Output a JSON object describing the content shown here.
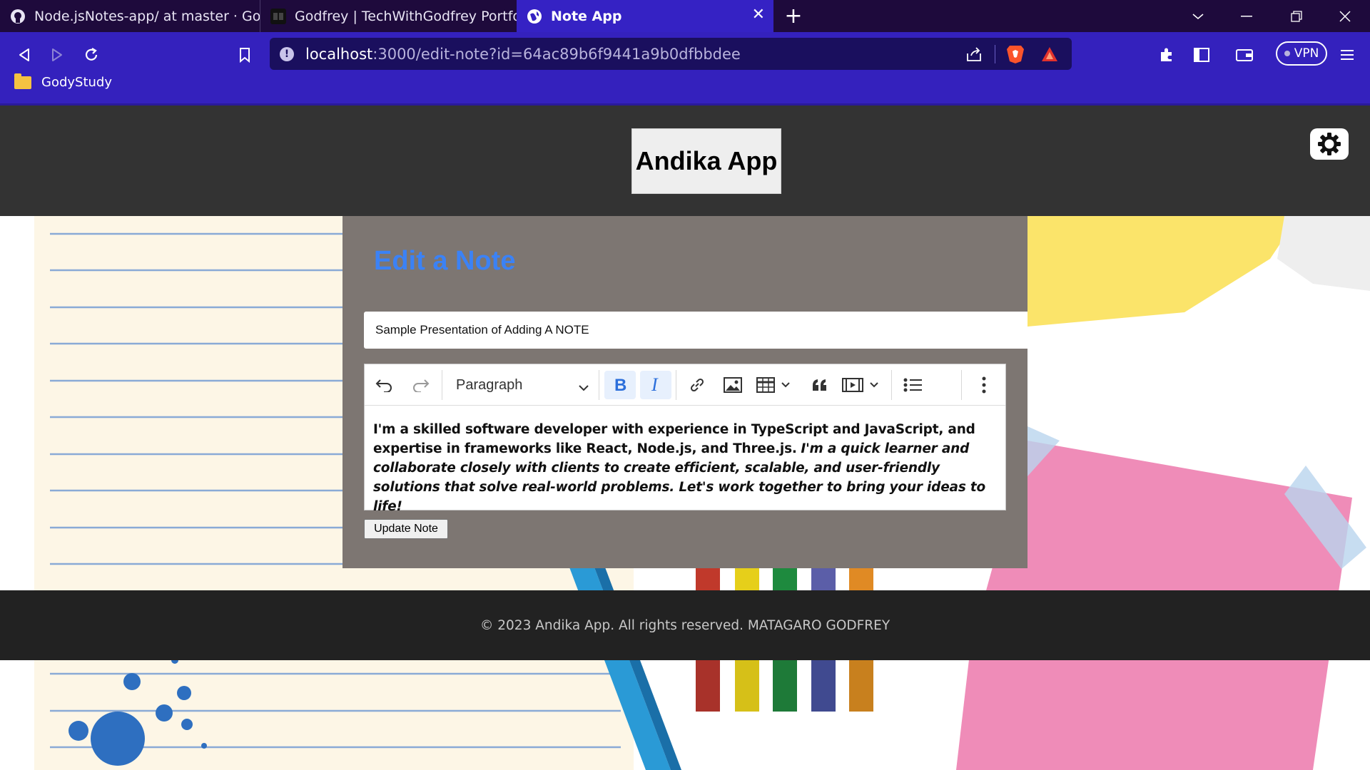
{
  "browser": {
    "tabs": [
      {
        "title": "Node.jsNotes-app/ at master · GodyRe",
        "icon": "github-icon"
      },
      {
        "title": "Godfrey | TechWithGodfrey Portfolio",
        "icon": "portfolio-icon"
      },
      {
        "title": "Note App",
        "icon": "globe-icon",
        "active": true
      }
    ],
    "new_tab": "+",
    "url": {
      "host": "localhost",
      "path": ":3000/edit-note?id=64ac89b6f9441a9b0dfbbdee"
    },
    "vpn_label": "VPN",
    "bookmarks": [
      {
        "label": "GodyStudy",
        "icon": "folder-icon"
      }
    ]
  },
  "site": {
    "brand": "Andika App",
    "theme_toggle_icon": "gear-icon"
  },
  "form": {
    "heading": "Edit a Note",
    "title_value": "Sample Presentation of Adding A NOTE",
    "editor": {
      "block_format": "Paragraph",
      "toolbar": [
        "undo-icon",
        "redo-icon",
        "bold-icon",
        "italic-icon",
        "link-icon",
        "image-icon",
        "table-icon",
        "blockquote-icon",
        "media-icon",
        "bulleted-list-icon",
        "more-icon"
      ],
      "content_bold": "I'm a skilled software developer with experience in TypeScript and JavaScript, and expertise in frameworks like React, Node.js, and Three.js.",
      "content_italic": "I'm a quick learner and collaborate closely with clients to create efficient, scalable, and user-friendly solutions that solve real-world problems. Let's work together to bring your ideas to life!"
    },
    "submit_label": "Update Note"
  },
  "footer": {
    "text": "© 2023 Andika App. All rights reserved. MATAGARO GODFREY"
  },
  "colors": {
    "tab_strip": "#1e0a3c",
    "toolbar": "#3421bd",
    "header": "#333333",
    "panel": "#7d7672",
    "heading": "#3b82f6",
    "footer": "#222222"
  }
}
